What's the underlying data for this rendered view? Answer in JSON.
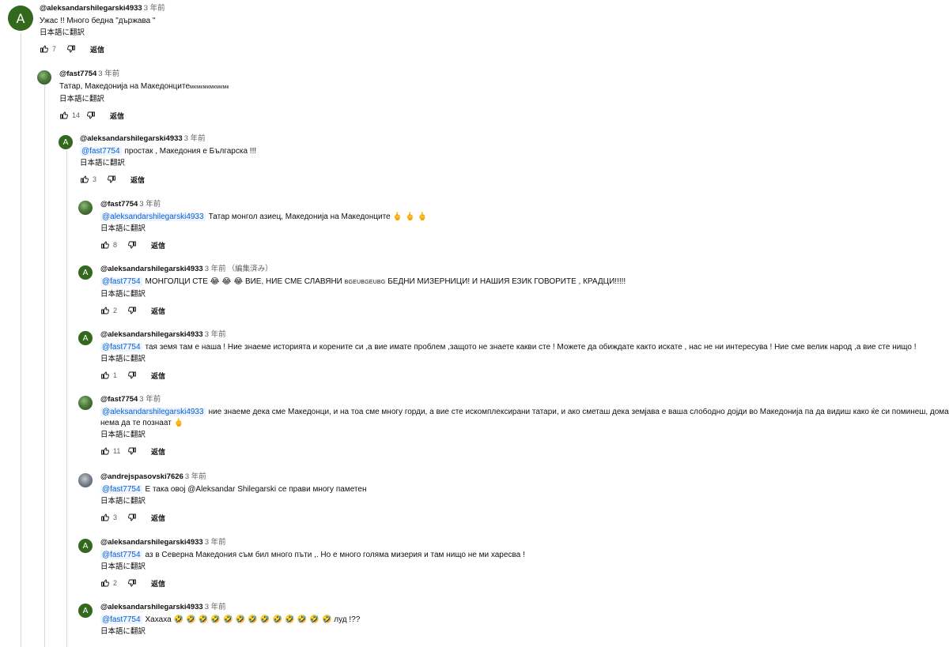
{
  "ui": {
    "reply_label": "返信",
    "translate_label": "日本語に翻訳"
  },
  "comments": [
    {
      "author": "@aleksandarshilegarski4933",
      "time": "3 年前",
      "avatar_letter": "A",
      "text": "Ужас !! Много бедна \"държава \"",
      "likes": "7"
    },
    {
      "author": "@fast7754",
      "time": "3 年前",
      "text_main": "Татар, Македонија на Македонците",
      "text_small": "мкмкмкмкмкмк",
      "likes": "14"
    },
    {
      "author": "@aleksandarshilegarski4933",
      "time": "3 年前",
      "avatar_letter": "A",
      "mention": "@fast7754",
      "text": "простак , Македония е Българска !!!",
      "likes": "3"
    },
    {
      "author": "@fast7754",
      "time": "3 年前",
      "mention": "@aleksandarshilegarski4933",
      "text": "Татар монгол азиец, Македонија на Македонците",
      "emoji": "🖕 🖕 🖕",
      "likes": "8"
    },
    {
      "author": "@aleksandarshilegarski4933",
      "time": "3 年前",
      "edited": "（編集済み）",
      "avatar_letter": "A",
      "mention": "@fast7754",
      "text_a": "МОНГОЛЦИ СТЕ",
      "emoji": "😂 😂 😂",
      "text_b": "ВИЕ, НИЕ СМЕ  СЛАВЯНИ",
      "text_small": "BGEUBGEUBG",
      "text_c": "БЕДНИ  МИЗЕРНИЦИ! И НАШИЯ ЕЗИК ГОВОРИТЕ , КРАДЦИ!!!!!",
      "likes": "2"
    },
    {
      "author": "@aleksandarshilegarski4933",
      "time": "3 年前",
      "avatar_letter": "A",
      "mention": "@fast7754",
      "text": "тая земя там е наша ! Ние знаеме историята и корените си ,а вие имате проблем ,защото не знаете какви сте !  Можете да обиждате както искате , нас не ни интересува ! Ние сме велик народ ,а вие сте нищо !",
      "likes": "1"
    },
    {
      "author": "@fast7754",
      "time": "3 年前",
      "mention": "@aleksandarshilegarski4933",
      "text": "ние знаеме дека сме Македонци, и на тоа сме многу горди, а вие сте искомплексирани татари, и ако сметаш дека земјава е ваша слободно дојди во Македонија па да видиш како ќе си поминеш, дома нема да те познаат",
      "emoji": "🖕",
      "likes": "11"
    },
    {
      "author": "@andrejspasovski7626",
      "time": "3 年前",
      "mention": "@fast7754",
      "text": "Е така овој @Aleksandar Shilegarski се прави многу паметен",
      "likes": "3"
    },
    {
      "author": "@aleksandarshilegarski4933",
      "time": "3 年前",
      "avatar_letter": "A",
      "mention": "@fast7754",
      "text": "аз в Северна Македония съм бил много пъти ,. Но  е много голяма мизерия и там нищо не ми харесва !",
      "likes": "2"
    },
    {
      "author": "@aleksandarshilegarski4933",
      "time": "3 年前",
      "avatar_letter": "A",
      "mention": "@fast7754",
      "text_a": "Хахаха",
      "emoji": "🤣 🤣 🤣 🤣 🤣 🤣 🤣 🤣 🤣 🤣 🤣 🤣 🤣",
      "text_b": "луд !??"
    }
  ]
}
